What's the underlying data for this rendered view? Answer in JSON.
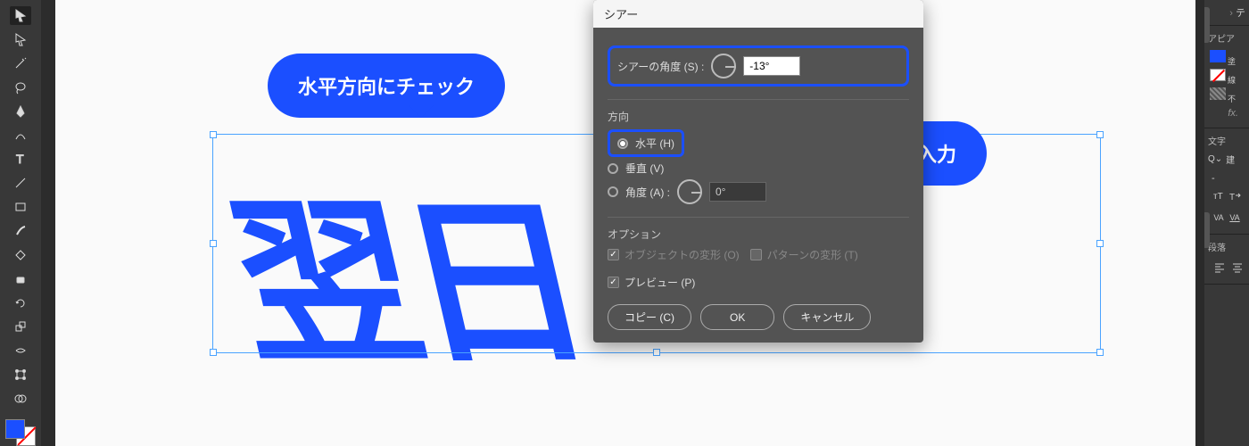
{
  "callouts": {
    "horizontal_check": "水平方向にチェック",
    "enter_angle": "角度を入力"
  },
  "canvas": {
    "text": "翌日"
  },
  "dialog": {
    "title": "シアー",
    "shear_angle_label": "シアーの角度 (S) :",
    "shear_angle_value": "-13°",
    "axis_label": "方向",
    "axis_horizontal": "水平 (H)",
    "axis_vertical": "垂直 (V)",
    "axis_angle_label": "角度 (A) :",
    "axis_angle_value": "0°",
    "options_label": "オプション",
    "opt_objects": "オブジェクトの変形 (O)",
    "opt_patterns": "パターンの変形 (T)",
    "preview": "プレビュー (P)",
    "btn_copy": "コピー (C)",
    "btn_ok": "OK",
    "btn_cancel": "キャンセル"
  },
  "right_panel": {
    "expand": "テ",
    "appearance": "アピア",
    "fx": "fx.",
    "character": "文字",
    "search": "建",
    "none_dash": "-",
    "paragraph": "段落"
  },
  "tool_icons": [
    "selection",
    "direct-select",
    "magic-wand",
    "lasso",
    "pen",
    "curvature",
    "type",
    "line",
    "rectangle",
    "brush",
    "shaper",
    "eraser",
    "rotate",
    "scale",
    "width",
    "free-transform",
    "shape-builder",
    "perspective",
    "mesh",
    "gradient",
    "eyedropper"
  ]
}
